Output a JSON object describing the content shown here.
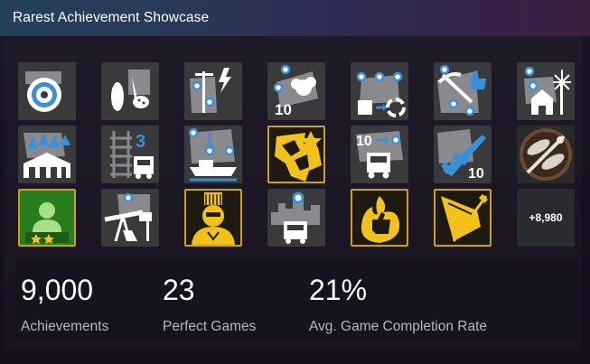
{
  "header": {
    "title": "Rarest Achievement Showcase"
  },
  "tiles": [
    {
      "icon": "gear-ring-icon"
    },
    {
      "icon": "crops-icon"
    },
    {
      "icon": "map-power-icon"
    },
    {
      "icon": "cotton-map-icon",
      "badge": "10"
    },
    {
      "icon": "recycle-route-icon"
    },
    {
      "icon": "mining-thumbs-icon"
    },
    {
      "icon": "farm-windmill-icon"
    },
    {
      "icon": "forest-depot-icon"
    },
    {
      "icon": "rail-truck-icon",
      "badge": "3"
    },
    {
      "icon": "ship-route-icon"
    },
    {
      "icon": "gold-continent-icon"
    },
    {
      "icon": "truck-route-icon",
      "badge": "10"
    },
    {
      "icon": "plane-icon",
      "badge": "10"
    },
    {
      "icon": "dragonfly-icon"
    },
    {
      "icon": "green-avatar-icon"
    },
    {
      "icon": "oil-pump-icon"
    },
    {
      "icon": "gold-hero-icon"
    },
    {
      "icon": "city-truck-icon"
    },
    {
      "icon": "gold-thumbs-icon"
    },
    {
      "icon": "gold-plane-icon"
    },
    {
      "icon": "more-icon",
      "label": "+8,980"
    }
  ],
  "stats": [
    {
      "value": "9,000",
      "label": "Achievements"
    },
    {
      "value": "23",
      "label": "Perfect Games"
    },
    {
      "value": "21%",
      "label": "Avg. Game Completion Rate"
    }
  ]
}
